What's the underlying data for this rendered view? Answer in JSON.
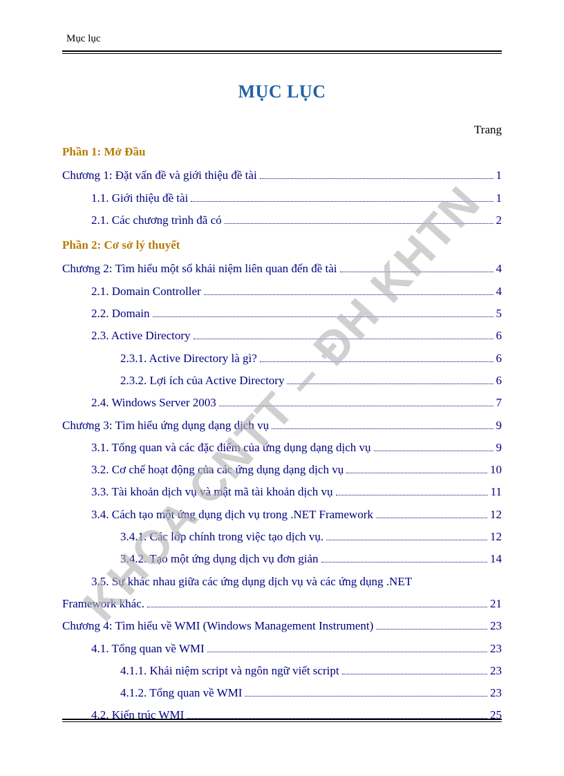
{
  "header": "Mục lục",
  "title": "MỤC LỤC",
  "page_label": "Trang",
  "watermark": "KHOA CNTT – ĐH KHTN",
  "entries": [
    {
      "type": "part",
      "text": "Phần 1: Mở Đầu"
    },
    {
      "level": 0,
      "text": "Chương 1: Đặt vấn đề và giới thiệu đề tài",
      "page": "1"
    },
    {
      "level": 1,
      "text": "1.1. Giới thiệu đề tài",
      "page": "1"
    },
    {
      "level": 1,
      "text": "2.1. Các chương trình đã có",
      "page": "2"
    },
    {
      "type": "part",
      "text": "Phần 2: Cơ sở lý thuyết"
    },
    {
      "level": 0,
      "text": "Chương 2: Tìm hiểu một số khái niệm liên quan đến đề tài",
      "page": "4"
    },
    {
      "level": 1,
      "text": "2.1. Domain Controller",
      "page": "4"
    },
    {
      "level": 1,
      "text": "2.2. Domain",
      "page": "5"
    },
    {
      "level": 1,
      "text": "2.3. Active Directory",
      "page": "6"
    },
    {
      "level": 2,
      "text": "2.3.1. Active Directory là gì?",
      "page": "6"
    },
    {
      "level": 2,
      "text": "2.3.2. Lợi ích của Active Directory",
      "page": "6"
    },
    {
      "level": 1,
      "text": "2.4. Windows Server 2003",
      "page": "7"
    },
    {
      "level": 0,
      "text": "Chương 3: Tìm hiểu ứng dụng dạng dịch vụ",
      "page": "9"
    },
    {
      "level": 1,
      "text": "3.1. Tổng quan và các đặc điểm của ứng dụng dạng dịch vụ",
      "page": "9"
    },
    {
      "level": 1,
      "text": "3.2. Cơ chế hoạt động của các ứng dụng dạng dịch vụ",
      "page": "10"
    },
    {
      "level": 1,
      "text": "3.3. Tài khoản dịch vụ và mật mã tài khoản dịch vụ",
      "page": "11"
    },
    {
      "level": 1,
      "text": "3.4. Cách tạo một ứng dụng dịch vụ trong .NET Framework",
      "page": "12"
    },
    {
      "level": 2,
      "text": "3.4.1. Các lớp chính trong việc tạo dịch vụ.",
      "page": "12"
    },
    {
      "level": 2,
      "text": "3.4.2. Tạo một ứng dụng dịch vụ đơn giản",
      "page": "14"
    },
    {
      "level": 1,
      "type": "multi",
      "text1": "3.5. Sự khác nhau giữa các ứng dụng dịch vụ và các ứng dụng .NET",
      "text2": "Framework khác.",
      "page": "21"
    },
    {
      "level": 0,
      "text": "Chương 4: Tìm hiểu về WMI (Windows Management Instrument)",
      "page": "23"
    },
    {
      "level": 1,
      "text": "4.1. Tổng quan về WMI",
      "page": "23"
    },
    {
      "level": 2,
      "text": "4.1.1. Khái niệm script và ngôn ngữ viết script",
      "page": "23"
    },
    {
      "level": 2,
      "text": "4.1.2. Tổng quan về WMI",
      "page": "23"
    },
    {
      "level": 1,
      "text": "4.2. Kiến trúc WMI",
      "page": "25"
    }
  ]
}
